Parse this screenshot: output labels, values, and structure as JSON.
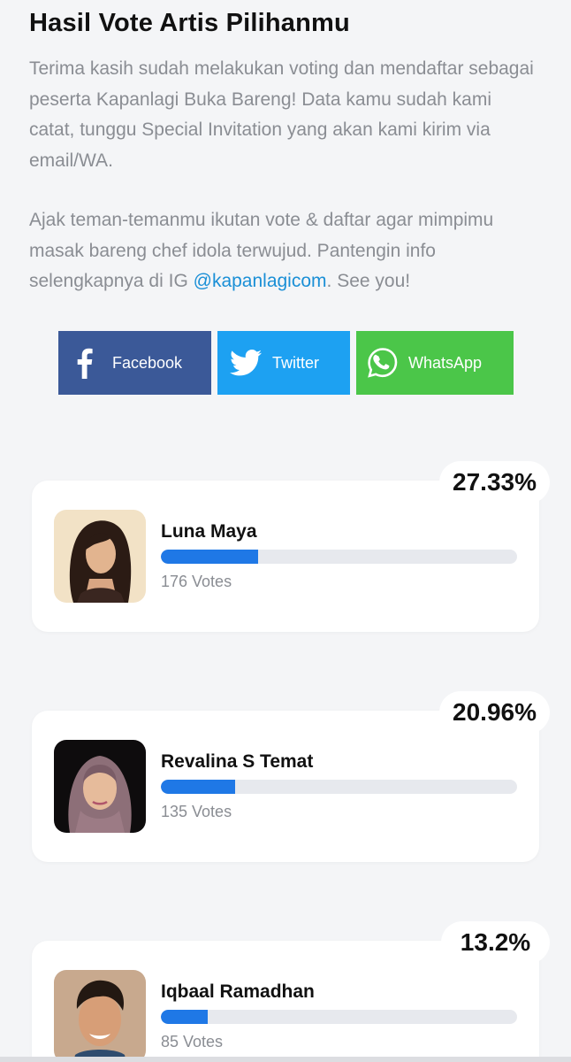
{
  "header": {
    "title": "Hasil Vote Artis Pilihanmu"
  },
  "intro": {
    "paragraph1": "Terima kasih sudah melakukan voting dan mendaftar sebagai peserta Kapanlagi Buka Bareng! Data kamu sudah kami catat, tunggu Special Invitation yang akan kami kirim via email/WA.",
    "paragraph2_before": "Ajak teman-temanmu ikutan vote & daftar agar mimpimu masak bareng chef idola terwujud. Pantengin info selengkapnya di IG ",
    "paragraph2_link": "@kapanlagicom",
    "paragraph2_after": ". See you!"
  },
  "share": {
    "facebook_label": "Facebook",
    "twitter_label": "Twitter",
    "whatsapp_label": "WhatsApp",
    "facebook_color": "#3b5998",
    "twitter_color": "#1da1f2",
    "whatsapp_color": "#4bc649"
  },
  "results": [
    {
      "name": "Luna Maya",
      "percent_label": "27.33%",
      "percent": 27.33,
      "votes_label": "176 Votes",
      "avatar_icon": "avatar-photo"
    },
    {
      "name": "Revalina S Temat",
      "percent_label": "20.96%",
      "percent": 20.96,
      "votes_label": "135 Votes",
      "avatar_icon": "avatar-photo"
    },
    {
      "name": "Iqbaal Ramadhan",
      "percent_label": "13.2%",
      "percent": 13.2,
      "votes_label": "85 Votes",
      "avatar_icon": "avatar-photo"
    }
  ],
  "colors": {
    "progress_fill": "#1f78e6",
    "progress_track": "#e7e9ee",
    "link": "#1a8fd6"
  }
}
